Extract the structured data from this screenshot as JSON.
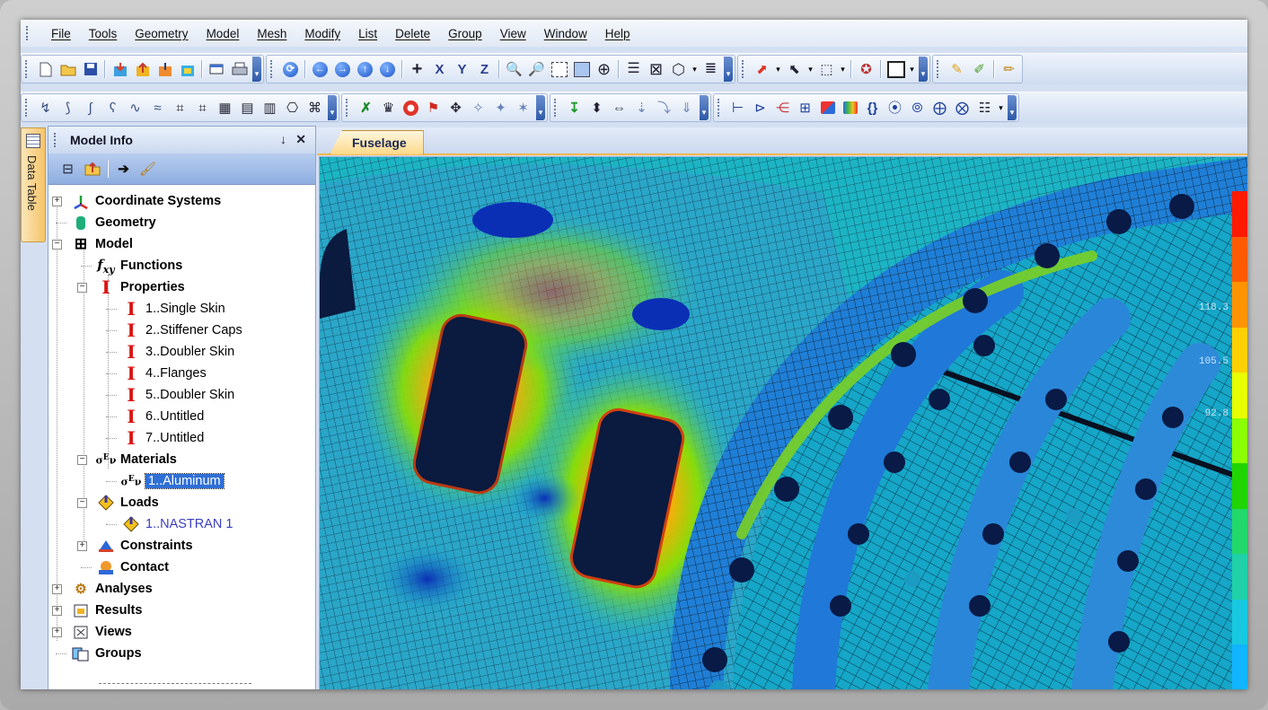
{
  "menu": [
    "File",
    "Tools",
    "Geometry",
    "Model",
    "Mesh",
    "Modify",
    "List",
    "Delete",
    "Group",
    "View",
    "Window",
    "Help"
  ],
  "side_tab": {
    "label": "Data Table"
  },
  "panel": {
    "title": "Model Info",
    "pin": "↓",
    "close": "✕"
  },
  "tree": [
    {
      "label": "Coordinate Systems",
      "icon": "coordinate-systems-icon",
      "level": 0,
      "expander": "+",
      "bold": true
    },
    {
      "label": "Geometry",
      "icon": "geometry-icon",
      "level": 0,
      "expander": "",
      "bold": true
    },
    {
      "label": "Model",
      "icon": "model-grid-icon",
      "level": 0,
      "expander": "−",
      "bold": true
    },
    {
      "label": "Functions",
      "icon": "functions-fxy-icon",
      "level": 1,
      "expander": "",
      "bold": true
    },
    {
      "label": "Properties",
      "icon": "property-ibeam-icon",
      "level": 1,
      "expander": "−",
      "bold": true
    },
    {
      "label": "1..Single Skin",
      "icon": "property-ibeam-icon",
      "level": 2,
      "expander": "",
      "bold": false
    },
    {
      "label": "2..Stiffener Caps",
      "icon": "property-ibeam-icon",
      "level": 2,
      "expander": "",
      "bold": false
    },
    {
      "label": "3..Doubler Skin",
      "icon": "property-ibeam-icon",
      "level": 2,
      "expander": "",
      "bold": false
    },
    {
      "label": "4..Flanges",
      "icon": "property-ibeam-icon",
      "level": 2,
      "expander": "",
      "bold": false
    },
    {
      "label": "5..Doubler Skin",
      "icon": "property-ibeam-icon",
      "level": 2,
      "expander": "",
      "bold": false
    },
    {
      "label": "6..Untitled",
      "icon": "property-ibeam-icon",
      "level": 2,
      "expander": "",
      "bold": false
    },
    {
      "label": "7..Untitled",
      "icon": "property-ibeam-icon",
      "level": 2,
      "expander": "",
      "bold": false
    },
    {
      "label": "Materials",
      "icon": "materials-icon",
      "level": 1,
      "expander": "−",
      "bold": true
    },
    {
      "label": "1..Aluminum",
      "icon": "materials-icon",
      "level": 2,
      "expander": "",
      "bold": false,
      "selected": true
    },
    {
      "label": "Loads",
      "icon": "loads-icon",
      "level": 1,
      "expander": "−",
      "bold": true
    },
    {
      "label": "1..NASTRAN 1",
      "icon": "loads-icon",
      "level": 2,
      "expander": "",
      "bold": false,
      "blue": true
    },
    {
      "label": "Constraints",
      "icon": "constraints-icon",
      "level": 1,
      "expander": "+",
      "bold": true
    },
    {
      "label": "Contact",
      "icon": "contact-icon",
      "level": 1,
      "expander": "",
      "bold": true
    },
    {
      "label": "Analyses",
      "icon": "analyses-icon",
      "level": 0,
      "expander": "+",
      "bold": true
    },
    {
      "label": "Results",
      "icon": "results-icon",
      "level": 0,
      "expander": "+",
      "bold": true
    },
    {
      "label": "Views",
      "icon": "views-icon",
      "level": 0,
      "expander": "+",
      "bold": true
    },
    {
      "label": "Groups",
      "icon": "groups-icon",
      "level": 0,
      "expander": "",
      "bold": true
    }
  ],
  "document": {
    "tab": "Fuselage"
  },
  "legend": {
    "labels": [
      "118.3",
      "105.5",
      "92.8"
    ],
    "colors": [
      "#ff1a00",
      "#ff5a00",
      "#ff9400",
      "#ffd000",
      "#e8ff00",
      "#8cff00",
      "#1fd400",
      "#22d86a",
      "#1fd0a8",
      "#18c8e0",
      "#11b4ff"
    ]
  }
}
